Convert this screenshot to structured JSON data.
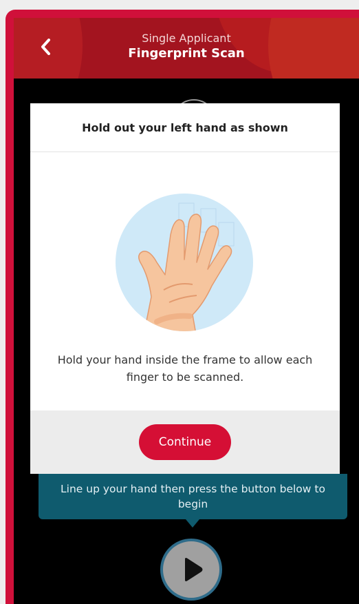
{
  "header": {
    "subtitle": "Single Applicant",
    "title": "Fingerprint Scan",
    "back_icon": "chevron-left-icon"
  },
  "modal": {
    "heading": "Hold out your left hand as shown",
    "illustration_icon": "left-hand-icon",
    "instruction": "Hold your hand inside the frame to allow each finger to be scanned.",
    "continue_label": "Continue"
  },
  "tooltip": {
    "text": "Line up your hand then press the button below to begin"
  },
  "play_icon": "play-icon",
  "colors": {
    "brand_red": "#d0103a",
    "header_red": "#a3141f",
    "tooltip_teal": "#0f5b6e",
    "hand_circle": "#cfe9f8"
  }
}
